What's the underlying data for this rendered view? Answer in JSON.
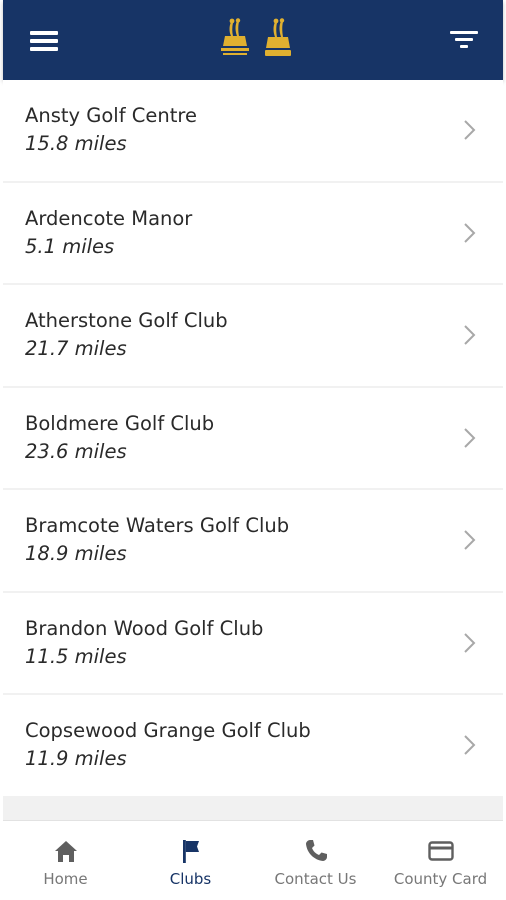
{
  "header": {
    "menu_icon": "hamburger-menu-icon",
    "filter_icon": "filter-icon",
    "logos": [
      "county-golf-logo",
      "mlgsa-logo"
    ],
    "color": "#173466"
  },
  "clubs": [
    {
      "name": "Ansty Golf Centre",
      "distance": "15.8 miles"
    },
    {
      "name": "Ardencote Manor",
      "distance": "5.1 miles"
    },
    {
      "name": "Atherstone Golf Club",
      "distance": "21.7 miles"
    },
    {
      "name": "Boldmere Golf Club",
      "distance": "23.6 miles"
    },
    {
      "name": "Bramcote Waters Golf Club",
      "distance": "18.9 miles"
    },
    {
      "name": "Brandon Wood Golf Club",
      "distance": "11.5 miles"
    },
    {
      "name": "Copsewood Grange Golf Club",
      "distance": "11.9 miles"
    }
  ],
  "bottom_nav": {
    "tabs": [
      {
        "label": "Home",
        "icon": "home-icon",
        "active": false
      },
      {
        "label": "Clubs",
        "icon": "flag-icon",
        "active": true
      },
      {
        "label": "Contact Us",
        "icon": "phone-icon",
        "active": false
      },
      {
        "label": "County Card",
        "icon": "card-icon",
        "active": false
      }
    ],
    "active_color": "#173466",
    "inactive_color": "#777777"
  }
}
